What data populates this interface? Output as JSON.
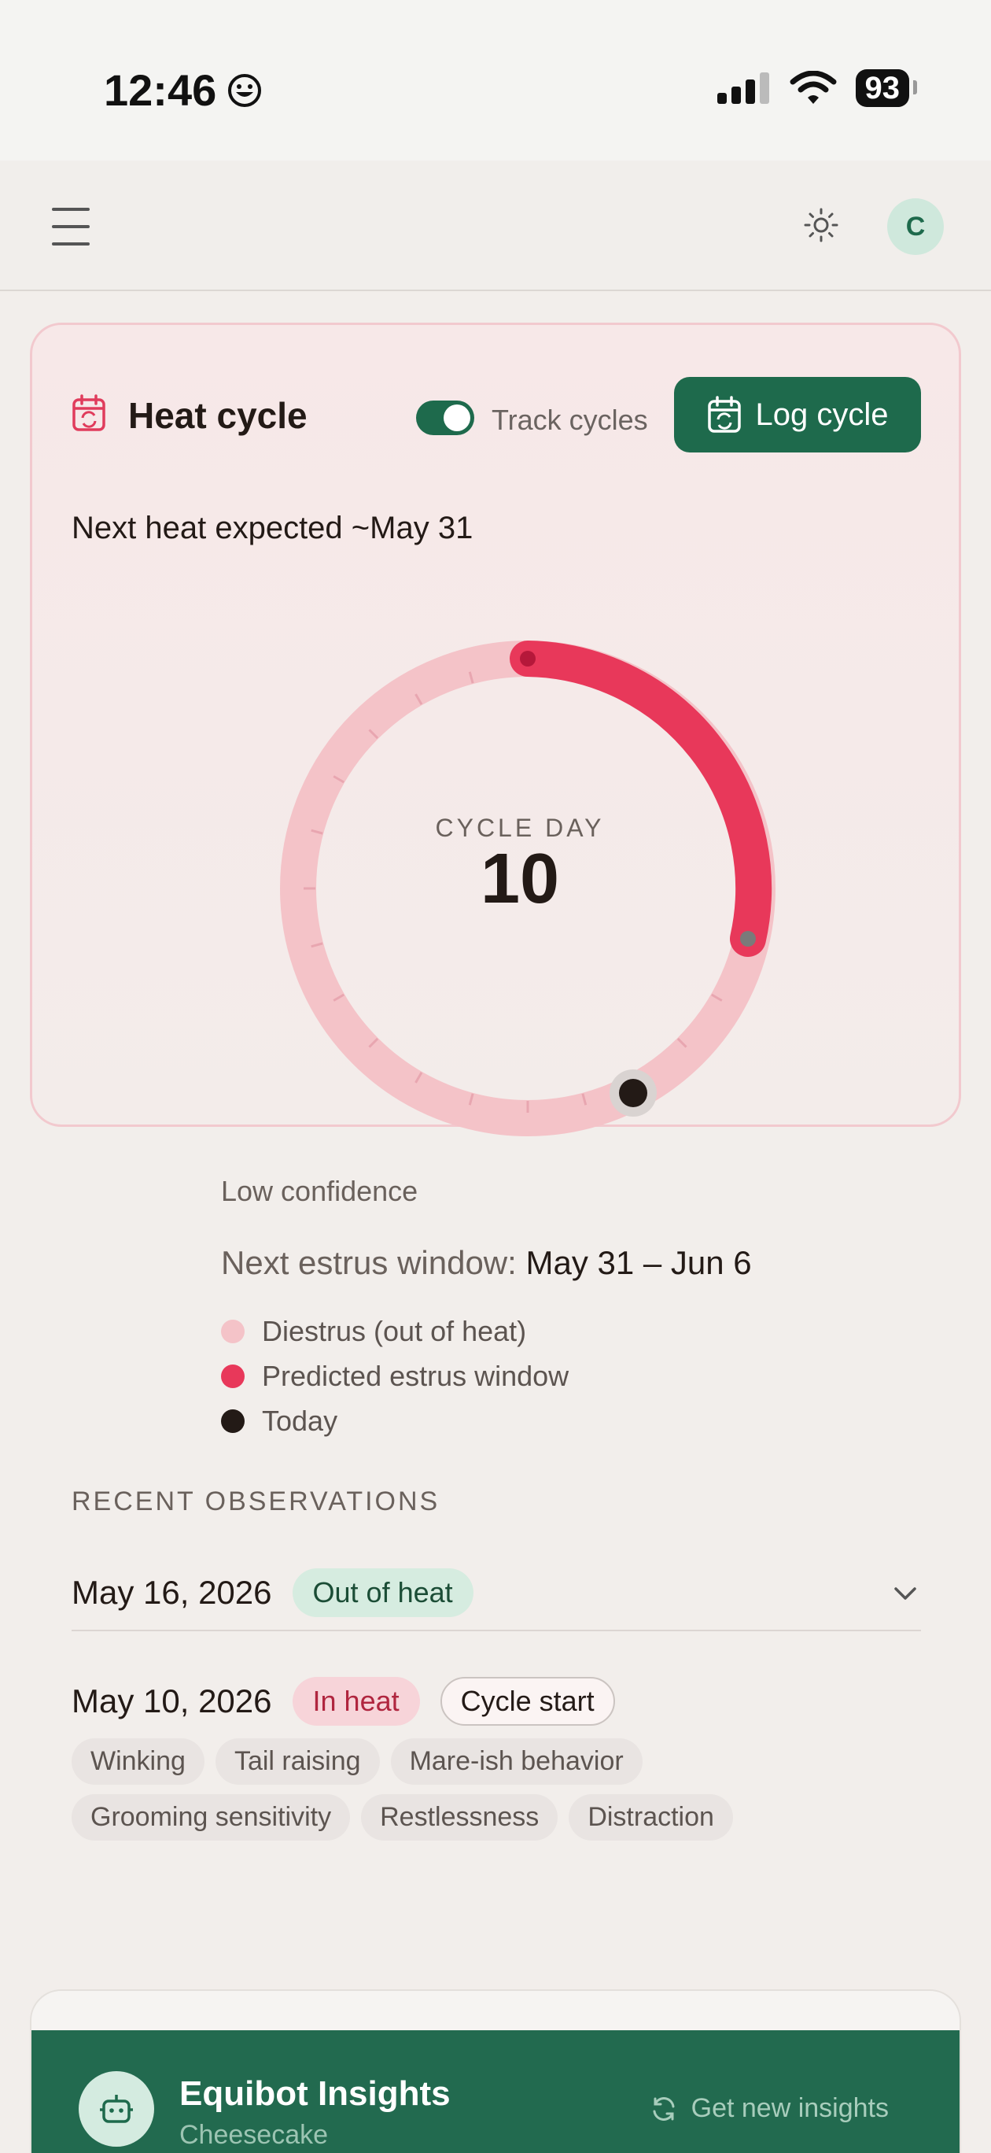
{
  "status_bar": {
    "time": "12:46",
    "battery": "93"
  },
  "header": {
    "avatar_initial": "C"
  },
  "heat_card": {
    "title": "Heat cycle",
    "toggle_label": "Track cycles",
    "toggle_on": true,
    "log_button": "Log cycle",
    "next_heat": "Next heat expected ~May 31",
    "cycle_day_label": "CYCLE DAY",
    "cycle_day": "10",
    "confidence": "Low confidence",
    "estrus_prefix": "Next estrus window: ",
    "estrus_dates": "May 31 – Jun 6",
    "legend": [
      {
        "label": "Diestrus (out of heat)",
        "color": "#f4c3c8"
      },
      {
        "label": "Predicted estrus window",
        "color": "#e8385a"
      },
      {
        "label": "Today",
        "color": "#231a16"
      }
    ],
    "colors": {
      "ring_base": "#f4c3c8",
      "ring_estrus": "#e8385a",
      "today": "#231a16",
      "accent": "#1e6a4c"
    }
  },
  "observations": {
    "section_label": "RECENT OBSERVATIONS",
    "items": [
      {
        "date": "May 16, 2026",
        "status": "Out of heat"
      },
      {
        "date": "May 10, 2026",
        "status": "In heat",
        "badge": "Cycle start",
        "tags": [
          "Winking",
          "Tail raising",
          "Mare-ish behavior",
          "Grooming sensitivity",
          "Restlessness",
          "Distraction"
        ]
      }
    ]
  },
  "insights": {
    "title": "Equibot Insights",
    "subtitle": "Cheesecake",
    "button": "Get new insights"
  }
}
